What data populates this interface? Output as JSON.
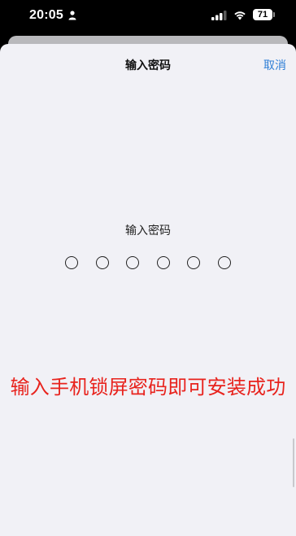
{
  "status_bar": {
    "time": "20:05",
    "battery": "71"
  },
  "nav": {
    "title": "输入密码",
    "cancel_label": "取消"
  },
  "passcode": {
    "prompt": "输入密码",
    "digits_total": 6,
    "digits_entered": 0
  },
  "hint": {
    "text": "输入手机锁屏密码即可安装成功",
    "color": "#e8231d"
  },
  "colors": {
    "accent": "#2f7fd6",
    "sheet_background": "#f1f1f6"
  }
}
